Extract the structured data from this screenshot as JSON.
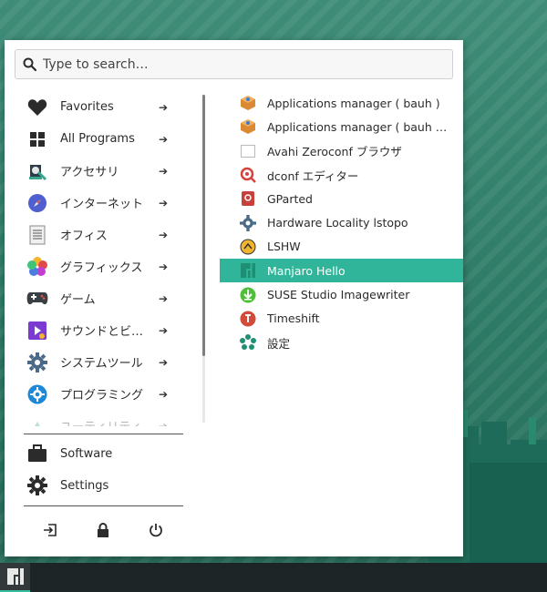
{
  "search": {
    "placeholder": "Type to search…"
  },
  "categories": [
    {
      "label": "Favorites",
      "icon": "heart-icon"
    },
    {
      "label": "All Programs",
      "icon": "grid-icon"
    },
    {
      "label": "アクセサリ",
      "icon": "accessories-icon"
    },
    {
      "label": "インターネット",
      "icon": "compass-icon"
    },
    {
      "label": "オフィス",
      "icon": "document-icon"
    },
    {
      "label": "グラフィックス",
      "icon": "graphics-palette-icon"
    },
    {
      "label": "ゲーム",
      "icon": "gamepad-icon"
    },
    {
      "label": "サウンドとビ…",
      "icon": "multimedia-icon"
    },
    {
      "label": "システムツール",
      "icon": "gear-icon"
    },
    {
      "label": "プログラミング",
      "icon": "programming-gear-icon"
    },
    {
      "label": "ユーティリティ",
      "icon": "utilities-icon"
    }
  ],
  "apps": [
    {
      "label": "Applications manager ( bauh )",
      "icon": "bauh-icon"
    },
    {
      "label": "Applications manager ( bauh …",
      "icon": "bauh-icon"
    },
    {
      "label": "Avahi Zeroconf ブラウザ",
      "icon": "window-icon"
    },
    {
      "label": "dconf エディター",
      "icon": "dconf-icon"
    },
    {
      "label": "GParted",
      "icon": "gparted-icon"
    },
    {
      "label": "Hardware Locality lstopo",
      "icon": "gear-icon"
    },
    {
      "label": "LSHW",
      "icon": "lshw-icon"
    },
    {
      "label": "Manjaro Hello",
      "icon": "manjaro-icon"
    },
    {
      "label": "SUSE Studio Imagewriter",
      "icon": "download-icon"
    },
    {
      "label": "Timeshift",
      "icon": "timeshift-icon"
    },
    {
      "label": "設定",
      "icon": "settings-flower-icon"
    }
  ],
  "selected_app": "Manjaro Hello",
  "bottom": {
    "software": "Software",
    "settings": "Settings"
  },
  "colors": {
    "accent": "#30b49a",
    "taskbar": "#1d2527"
  }
}
